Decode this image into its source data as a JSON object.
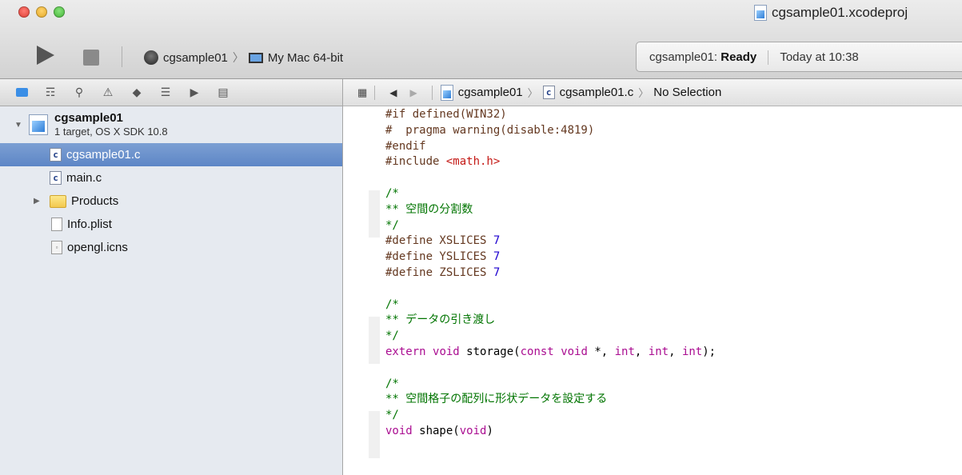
{
  "window": {
    "title": "cgsample01.xcodeproj"
  },
  "toolbar": {
    "run_icon": "play-icon",
    "stop_icon": "stop-icon",
    "scheme": "cgsample01",
    "destination": "My Mac 64-bit",
    "status_prefix": "cgsample01:",
    "status_state": "Ready",
    "status_time": "Today at 10:38"
  },
  "navigator": {
    "tab_icons": [
      "folder-icon",
      "symbol-icon",
      "search-icon",
      "issue-icon",
      "test-icon",
      "debug-icon",
      "breakpoint-icon",
      "log-icon"
    ],
    "project": {
      "name": "cgsample01",
      "subtitle": "1 target, OS X SDK 10.8"
    },
    "files": [
      {
        "label": "cgsample01.c",
        "type": "c",
        "selected": true
      },
      {
        "label": "main.c",
        "type": "c"
      },
      {
        "label": "Products",
        "type": "folder"
      },
      {
        "label": "Info.plist",
        "type": "plain"
      },
      {
        "label": "opengl.icns",
        "type": "icns"
      }
    ]
  },
  "jumpbar": {
    "project": "cgsample01",
    "file": "cgsample01.c",
    "selection": "No Selection"
  },
  "code": [
    [
      [
        "pp",
        "#if defined(WIN32)"
      ]
    ],
    [
      [
        "pp",
        "#  pragma warning(disable:4819)"
      ]
    ],
    [
      [
        "pp",
        "#endif"
      ]
    ],
    [
      [
        "pp",
        "#include "
      ],
      [
        "str",
        "<math.h>"
      ]
    ],
    [
      [
        "",
        ""
      ]
    ],
    [
      [
        "cm",
        "/*"
      ]
    ],
    [
      [
        "cm",
        "** 空間の分割数"
      ]
    ],
    [
      [
        "cm",
        "*/"
      ]
    ],
    [
      [
        "pp",
        "#define XSLICES "
      ],
      [
        "num",
        "7"
      ]
    ],
    [
      [
        "pp",
        "#define YSLICES "
      ],
      [
        "num",
        "7"
      ]
    ],
    [
      [
        "pp",
        "#define ZSLICES "
      ],
      [
        "num",
        "7"
      ]
    ],
    [
      [
        "",
        ""
      ]
    ],
    [
      [
        "cm",
        "/*"
      ]
    ],
    [
      [
        "cm",
        "** データの引き渡し"
      ]
    ],
    [
      [
        "cm",
        "*/"
      ]
    ],
    [
      [
        "kw",
        "extern"
      ],
      [
        "",
        " "
      ],
      [
        "kw",
        "void"
      ],
      [
        "",
        " storage("
      ],
      [
        "kw",
        "const"
      ],
      [
        "",
        " "
      ],
      [
        "kw",
        "void"
      ],
      [
        "",
        " *, "
      ],
      [
        "kw",
        "int"
      ],
      [
        "",
        ", "
      ],
      [
        "kw",
        "int"
      ],
      [
        "",
        ", "
      ],
      [
        "kw",
        "int"
      ],
      [
        "",
        ");"
      ]
    ],
    [
      [
        "",
        ""
      ]
    ],
    [
      [
        "cm",
        "/*"
      ]
    ],
    [
      [
        "cm",
        "** 空間格子の配列に形状データを設定する"
      ]
    ],
    [
      [
        "cm",
        "*/"
      ]
    ],
    [
      [
        "kw",
        "void"
      ],
      [
        "",
        " shape("
      ],
      [
        "kw",
        "void"
      ],
      [
        "",
        ")"
      ]
    ]
  ]
}
